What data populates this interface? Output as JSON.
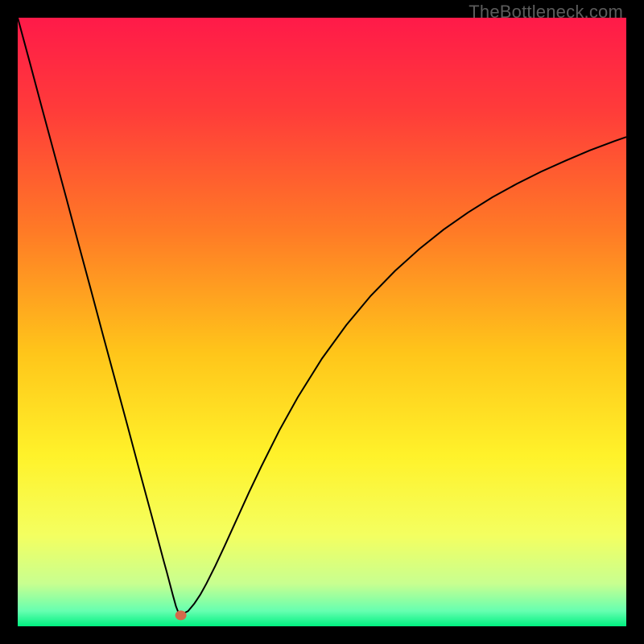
{
  "watermark": "TheBottleneck.com",
  "chart_data": {
    "type": "line",
    "title": "",
    "xlabel": "",
    "ylabel": "",
    "xlim": [
      0,
      1
    ],
    "ylim": [
      0,
      1
    ],
    "gradient_stops": [
      {
        "offset": 0.0,
        "color": "#ff1a49"
      },
      {
        "offset": 0.15,
        "color": "#ff3b3a"
      },
      {
        "offset": 0.35,
        "color": "#ff7a26"
      },
      {
        "offset": 0.55,
        "color": "#ffc51a"
      },
      {
        "offset": 0.72,
        "color": "#fff22a"
      },
      {
        "offset": 0.85,
        "color": "#f4ff60"
      },
      {
        "offset": 0.93,
        "color": "#c8ff90"
      },
      {
        "offset": 0.975,
        "color": "#66ffb0"
      },
      {
        "offset": 1.0,
        "color": "#00f080"
      }
    ],
    "marker": {
      "x": 0.268,
      "y": 0.982,
      "color": "#d46a4a",
      "r": 7
    },
    "series": [
      {
        "name": "curve",
        "type": "line",
        "color": "#000000",
        "width": 2,
        "x": [
          0.0,
          0.02,
          0.04,
          0.06,
          0.08,
          0.1,
          0.12,
          0.14,
          0.16,
          0.18,
          0.2,
          0.22,
          0.24,
          0.245,
          0.25,
          0.255,
          0.26,
          0.265,
          0.27,
          0.28,
          0.29,
          0.3,
          0.31,
          0.325,
          0.34,
          0.36,
          0.38,
          0.4,
          0.43,
          0.46,
          0.5,
          0.54,
          0.58,
          0.62,
          0.66,
          0.7,
          0.74,
          0.78,
          0.82,
          0.86,
          0.9,
          0.94,
          0.98,
          1.0
        ],
        "y": [
          0.0,
          0.074,
          0.149,
          0.223,
          0.297,
          0.372,
          0.446,
          0.521,
          0.595,
          0.669,
          0.744,
          0.818,
          0.893,
          0.911,
          0.93,
          0.949,
          0.967,
          0.98,
          0.98,
          0.975,
          0.963,
          0.948,
          0.93,
          0.9,
          0.868,
          0.824,
          0.78,
          0.738,
          0.678,
          0.624,
          0.56,
          0.505,
          0.457,
          0.416,
          0.38,
          0.348,
          0.32,
          0.295,
          0.273,
          0.253,
          0.235,
          0.218,
          0.203,
          0.196
        ]
      }
    ]
  }
}
